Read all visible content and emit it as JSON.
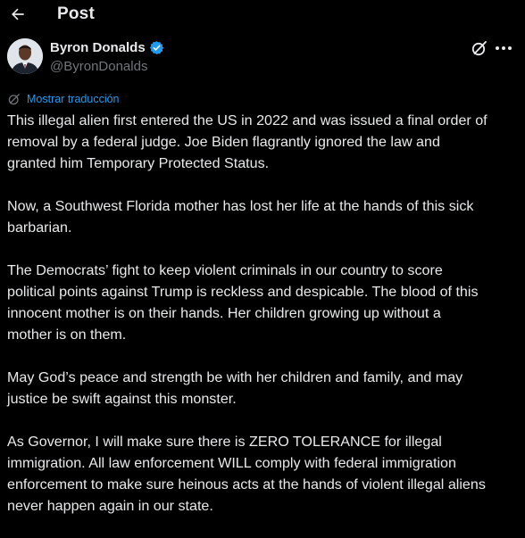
{
  "header": {
    "title": "Post"
  },
  "author": {
    "name": "Byron Donalds",
    "handle": "@ByronDonalds",
    "verified": true
  },
  "translate": {
    "label": "Mostrar traducción"
  },
  "post": {
    "paragraphs": [
      "This illegal alien first entered the US in 2022 and was issued a final order of\nremoval by a federal judge. Joe Biden flagrantly ignored the law and\ngranted him Temporary Protected Status.",
      "Now, a Southwest Florida mother has lost her life at the hands of this sick\nbarbarian.",
      "The Democrats’ fight to keep violent criminals in our country to score\npolitical points against Trump is reckless and despicable. The blood of this\ninnocent mother is on their hands. Her children growing up without a\nmother is on them.",
      "May God’s peace and strength be with her children and family, and may\njustice be swift against this monster.",
      "As Governor, I will make sure there is ZERO TOLERANCE for illegal\nimmigration. All law enforcement WILL comply with federal immigration\nenforcement to make sure heinous acts at the hands of violent illegal aliens\nnever happen again in our state."
    ]
  },
  "colors": {
    "background": "#000000",
    "text": "#e7e9ea",
    "secondary": "#71767b",
    "accent": "#1d9bf0"
  },
  "icons": {
    "back": "arrow-left-icon",
    "verified": "verified-badge-icon",
    "grok": "grok-icon",
    "more": "more-dots-icon",
    "translate": "translate-icon"
  }
}
